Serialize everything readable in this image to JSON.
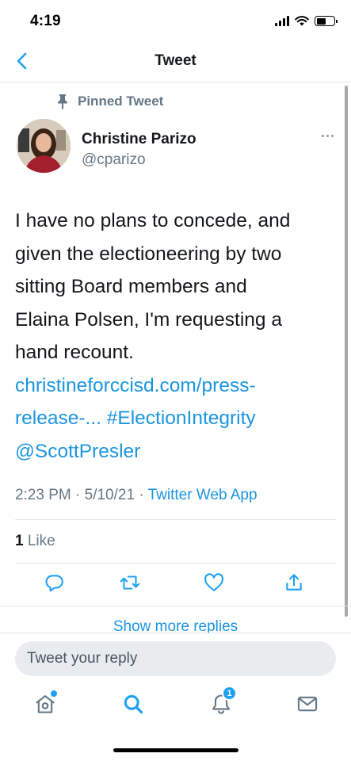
{
  "status_bar": {
    "time": "4:19"
  },
  "header": {
    "title": "Tweet"
  },
  "tweet": {
    "pinned_label": "Pinned Tweet",
    "author_name": "Christine Parizo",
    "author_handle": "@cparizo",
    "text_lines": [
      {
        "text": "I have no plans to concede, and",
        "link": false
      },
      {
        "text": "given the electioneering by two",
        "link": false
      },
      {
        "text": "sitting Board members and",
        "link": false
      },
      {
        "text": "Elaina Polsen, I'm requesting a",
        "link": false
      },
      {
        "text": "hand recount.",
        "link": false
      },
      {
        "text": "christineforccisd.com/press-",
        "link": true
      },
      {
        "text": "release-... #ElectionIntegrity",
        "link": true
      },
      {
        "text": "@ScottPresler",
        "link": true
      }
    ],
    "timestamp": "2:23 PM · 5/10/21 · ",
    "source": "Twitter Web App",
    "like_count": "1",
    "like_label": " Like"
  },
  "show_more_replies": "Show more replies",
  "reply": {
    "placeholder": "Tweet your reply"
  },
  "tab_bar": {
    "items": [
      "home-icon",
      "search-icon",
      "notifications-icon",
      "messages-icon"
    ],
    "notification_count": "1"
  },
  "colors": {
    "accent": "#1da1f2",
    "link": "#1b95e0",
    "secondary_text": "#657786"
  }
}
